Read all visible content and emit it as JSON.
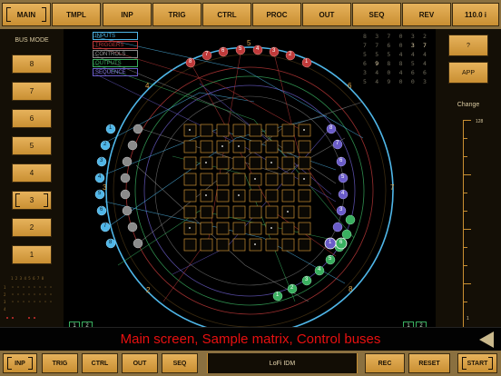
{
  "top_tabs": [
    {
      "label": "MAIN",
      "selected": true
    },
    {
      "label": "TMPL",
      "selected": false
    },
    {
      "label": "INP",
      "selected": false
    },
    {
      "label": "TRIG",
      "selected": false
    },
    {
      "label": "CTRL",
      "selected": false
    },
    {
      "label": "PROC",
      "selected": false
    },
    {
      "label": "OUT",
      "selected": false
    },
    {
      "label": "SEQ",
      "selected": false
    },
    {
      "label": "REV",
      "selected": false
    },
    {
      "label": "110.0 i",
      "selected": false
    }
  ],
  "bus_mode": {
    "title": "BUS MODE",
    "items": [
      "8",
      "7",
      "6",
      "5",
      "4",
      "3",
      "2",
      "1"
    ],
    "selected": "3"
  },
  "legend": [
    {
      "label": "INPUTS",
      "color": "#4fb6e8"
    },
    {
      "label": "TRIGGERS",
      "color": "#c03a3a"
    },
    {
      "label": "CONTROLS",
      "color": "#8a8a8a"
    },
    {
      "label": "OUTPUTS",
      "color": "#3ab060"
    },
    {
      "label": "SEQUENCE",
      "color": "#6a5cc8"
    }
  ],
  "readout_rows": [
    [
      "8",
      "3",
      "7",
      "0",
      "3",
      "2"
    ],
    [
      "7",
      "7",
      "6",
      "0",
      "3",
      "7"
    ],
    [
      "5",
      "5",
      "5",
      "4",
      "4",
      "4"
    ],
    [
      "6",
      "9",
      "8",
      "8",
      "5",
      "4"
    ],
    [
      "3",
      "4",
      "0",
      "4",
      "6",
      "6"
    ],
    [
      "5",
      "4",
      "9",
      "0",
      "0",
      "3"
    ]
  ],
  "right_panel": {
    "help_label": "?",
    "app_label": "APP",
    "change_title": "Change",
    "slider_max": "128",
    "slider_min": "1"
  },
  "ring_numbers": [
    "1",
    "2",
    "3",
    "4",
    "5",
    "6",
    "7",
    "8"
  ],
  "node_numbers": [
    "1",
    "2",
    "3",
    "4",
    "5",
    "6",
    "7",
    "8"
  ],
  "bus_boxes": {
    "left_top": [
      "1",
      "2"
    ],
    "left_bottom": [
      "3",
      "4"
    ],
    "right": [
      "1",
      "2"
    ]
  },
  "mini_grid": {
    "header": "1 2 3 4 5 6 7 8",
    "row_labels": [
      "1",
      "2",
      "3",
      "4"
    ]
  },
  "caption": "Main screen, Sample matrix, Control buses",
  "bottom_tabs": [
    {
      "label": "INP",
      "selected": true
    },
    {
      "label": "TRIG",
      "selected": false
    },
    {
      "label": "CTRL",
      "selected": false
    },
    {
      "label": "OUT",
      "selected": false
    },
    {
      "label": "SEQ",
      "selected": false
    }
  ],
  "preset_name": "LoFi IDM",
  "rec_label": "REC",
  "reset_label": "RESET",
  "start_label": "START",
  "colors": {
    "accent": "#d9a24a",
    "inputs": "#4fb6e8",
    "triggers": "#c03a3a",
    "controls": "#8a8a8a",
    "outputs": "#3ab060",
    "sequence": "#6a5cc8",
    "caption": "#e81010"
  }
}
